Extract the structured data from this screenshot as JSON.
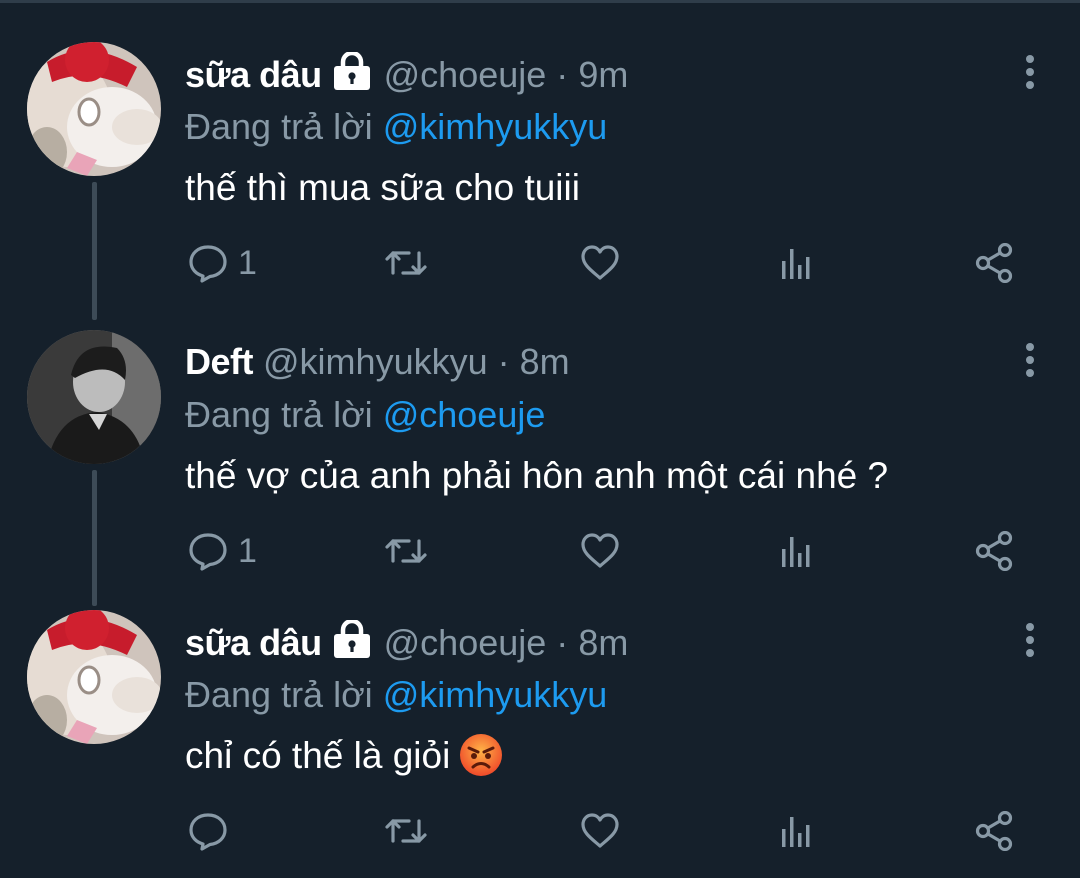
{
  "colors": {
    "background": "#15202b",
    "primary_text": "#ffffff",
    "secondary_text": "#8899a6",
    "link": "#1d9bf0",
    "thread_line": "#3d4b57"
  },
  "tweets": [
    {
      "author_name": "sữa dâu",
      "protected_icon": "lock-icon",
      "handle": "@choeuje",
      "separator": "·",
      "time": "9m",
      "reply_prefix": "Đang trả lời",
      "reply_to": "@kimhyukkyu",
      "text": "thế thì mua sữa cho tuiii",
      "reply_count": "1",
      "avatar": "hello-kitty-avatar"
    },
    {
      "author_name": "Deft",
      "handle": "@kimhyukkyu",
      "separator": "·",
      "time": "8m",
      "reply_prefix": "Đang trả lời",
      "reply_to": "@choeuje",
      "text": "thế vợ của anh phải hôn anh một cái nhé ?",
      "reply_count": "1",
      "avatar": "person-photo-avatar"
    },
    {
      "author_name": "sữa dâu",
      "protected_icon": "lock-icon",
      "handle": "@choeuje",
      "separator": "·",
      "time": "8m",
      "reply_prefix": "Đang trả lời",
      "reply_to": "@kimhyukkyu",
      "text": "chỉ có thế là giỏi",
      "text_emoji": "angry-face-emoji",
      "reply_count": "",
      "avatar": "hello-kitty-avatar"
    }
  ]
}
